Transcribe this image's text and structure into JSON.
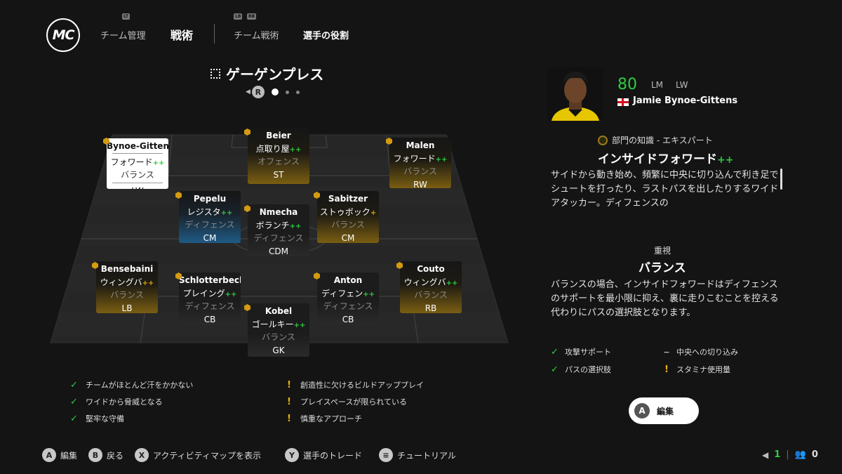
{
  "nav": {
    "logo": "MC",
    "tab_team": "チーム管理",
    "tab_tactics": "戦術",
    "tab_team_tactics": "チーム戦術",
    "tab_player_roles": "選手の役割",
    "hint_lt": "LT",
    "hint_lb": "LB",
    "hint_rb": "RB"
  },
  "formation": {
    "name": "ゲーゲンプレス",
    "pager_button": "R"
  },
  "players": [
    {
      "name": "Bynoe-Gittens",
      "role": "フォワード",
      "role_mark": "++",
      "focus": "バランス",
      "pos": "LW"
    },
    {
      "name": "Beier",
      "role": "点取り屋",
      "role_mark": "++",
      "focus": "オフェンス",
      "pos": "ST"
    },
    {
      "name": "Malen",
      "role": "フォワード",
      "role_mark": "++",
      "focus": "バランス",
      "pos": "RW"
    },
    {
      "name": "Pepelu",
      "role": "レジスタ",
      "role_mark": "++",
      "focus": "ディフェンス",
      "pos": "CM"
    },
    {
      "name": "Nmecha",
      "role": "ボランチ",
      "role_mark": "++",
      "focus": "ディフェンス",
      "pos": "CDM"
    },
    {
      "name": "Sabitzer",
      "role": "ストゥボック",
      "role_mark": "+",
      "focus": "バランス",
      "pos": "CM"
    },
    {
      "name": "Bensebaini",
      "role": "ウィングバ",
      "role_mark": "++",
      "focus": "バランス",
      "pos": "LB"
    },
    {
      "name": "Schlotterbeck",
      "role": "プレイング",
      "role_mark": "++",
      "focus": "ディフェンス",
      "pos": "CB"
    },
    {
      "name": "Anton",
      "role": "ディフェン",
      "role_mark": "++",
      "focus": "ディフェンス",
      "pos": "CB"
    },
    {
      "name": "Couto",
      "role": "ウィングバ",
      "role_mark": "++",
      "focus": "バランス",
      "pos": "RB"
    },
    {
      "name": "Kobel",
      "role": "ゴールキー",
      "role_mark": "++",
      "focus": "バランス",
      "pos": "GK"
    }
  ],
  "team_traits": {
    "positives": [
      "チームがほとんど汗をかかない",
      "ワイドから脅威となる",
      "堅牢な守備"
    ],
    "negatives": [
      "創造性に欠けるビルドアッププレイ",
      "プレイスペースが限られている",
      "慎重なアプローチ"
    ]
  },
  "selected": {
    "ovr": "80",
    "pos1": "LM",
    "pos2": "LW",
    "name": "Jamie Bynoe-Gittens",
    "knowledge": "部門の知識 - エキスパート",
    "role_name": "インサイドフォワード",
    "role_plus": "++",
    "role_desc": "サイドから動き始め、頻繁に中央に切り込んで利き足でシュートを打ったり、ラストパスを出したりするワイドアタッカー。ディフェンスの",
    "focus_label": "重視",
    "focus_value": "バランス",
    "focus_desc": "バランスの場合、インサイドフォワードはディフェンスのサポートを最小限に抑え、裏に走りこむことを控える代わりにパスの選択肢となります。",
    "perk1": "攻撃サポート",
    "perk2": "中央への切り込み",
    "perk3": "パスの選択肢",
    "perk4": "スタミナ使用量",
    "edit_button": "A",
    "edit_label": "編集"
  },
  "footer": {
    "a_label": "編集",
    "b_label": "戻る",
    "x_label": "アクティビティマップを表示",
    "y_label": "選手のトレード",
    "menu_label": "チュートリアル",
    "a_key": "A",
    "b_key": "B",
    "x_key": "X",
    "y_key": "Y",
    "menu_key": "≡",
    "count1": "1",
    "count2": "0"
  },
  "colors": {
    "accent_green": "#2ecc40",
    "warning_yellow": "#e8b10a",
    "gold_card": "#7a5e12",
    "blue_card": "#1f5a85"
  }
}
